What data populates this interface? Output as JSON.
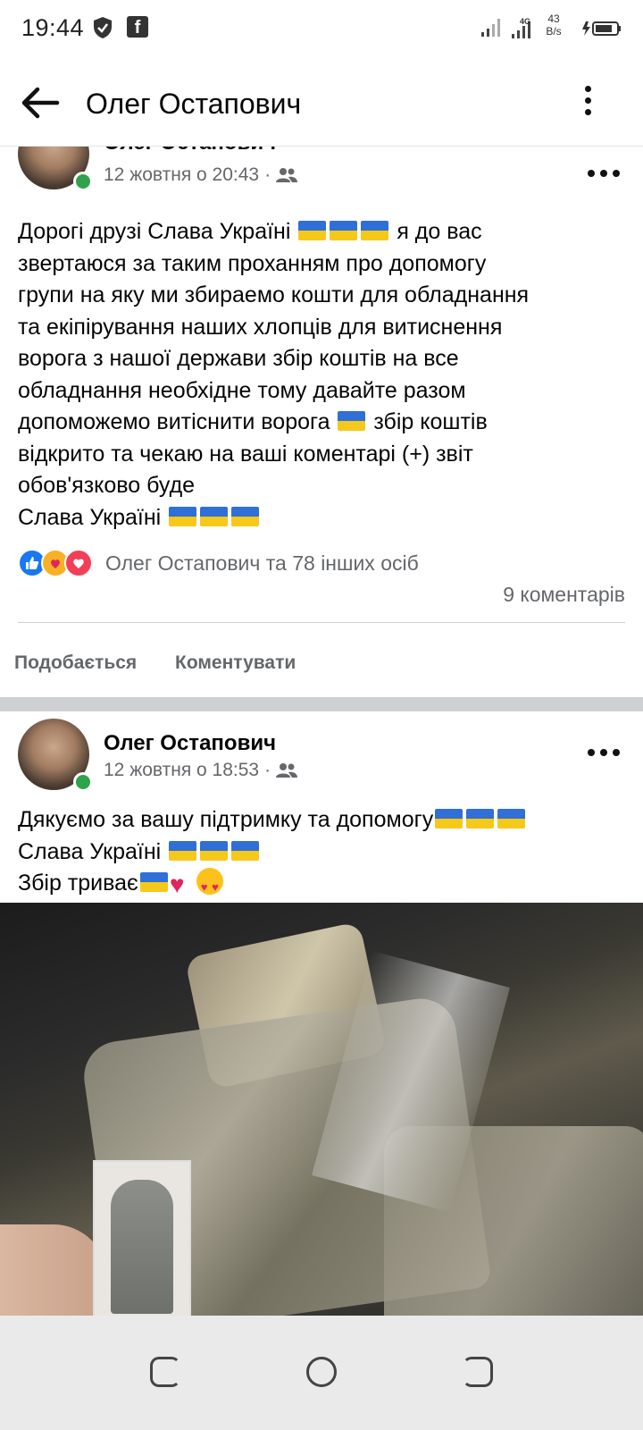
{
  "status_bar": {
    "time": "19:44",
    "network": "4G",
    "speed_value": "43",
    "speed_unit": "B/s"
  },
  "app_bar": {
    "title": "Олег Остапович"
  },
  "posts": [
    {
      "author": "Олег Остапович",
      "timestamp": "12 жовтня о 20:43",
      "text_segments": [
        "Дорогі друзі Слава Україні ",
        " я до вас\nзвертаюся за таким проханням про допомогу\nгрупи на яку ми збираемо кошти для обладнання\nта екіпірування наших хлопців для витиснення\nворога з нашої держави збір коштів на все\nобладнання необхідне тому давайте разом\nдопоможемо витіснити ворога ",
        " збір коштів\nвідкрито та чекаю на ваші коментарі (+) звіт\nобов'язково буде\nСлава Україні "
      ],
      "reactions_text": "Олег Остапович та 78 інших осіб",
      "comments_text": "9 коментарів",
      "actions": {
        "like": "Подобається",
        "comment": "Коментувати"
      }
    },
    {
      "author": "Олег Остапович",
      "timestamp": "12 жовтня о 18:53",
      "text_segments": [
        "Дякуємо за вашу підтримку та допомогу",
        "Слава Україні ",
        "Збір триває"
      ]
    }
  ],
  "colors": {
    "facebook_blue": "#1877f2",
    "online_green": "#31a24c",
    "secondary_text": "#65676b"
  }
}
